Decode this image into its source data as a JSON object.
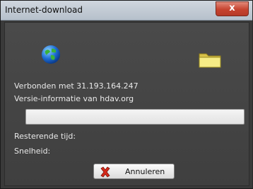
{
  "window": {
    "title": "Internet-download",
    "close_label": "x"
  },
  "status": {
    "connected_text": "Verbonden met 31.193.164.247",
    "info_text": "Versie-informatie van hdav.org",
    "remaining_time_label": "Resterende tijd:",
    "speed_label": "Snelheid:"
  },
  "progress": {
    "percent": 0
  },
  "buttons": {
    "cancel_label": "Annuleren"
  },
  "icons": {
    "globe": "globe-icon",
    "folder": "folder-icon",
    "cancel": "red-x-icon"
  }
}
